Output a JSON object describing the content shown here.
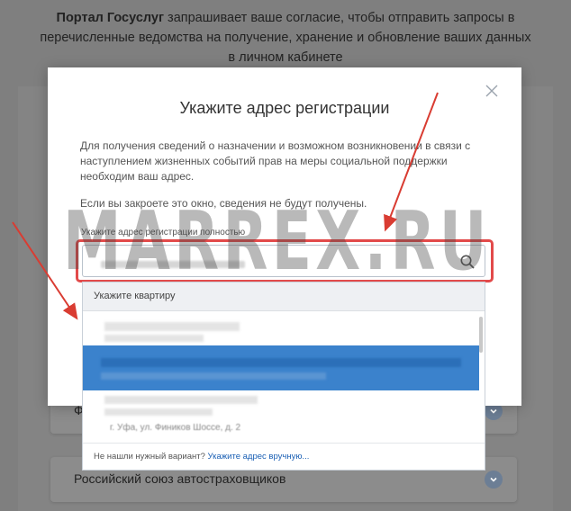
{
  "background": {
    "header_bold": "Портал Госуслуг",
    "header_text": " запрашивает ваше согласие, чтобы отправить запросы в перечисленные ведомства на получение, хранение и обновление ваших данных в личном кабинете",
    "row1_label": "Ф",
    "row2_label": "Российский союз автостраховщиков"
  },
  "modal": {
    "title": "Укажите адрес регистрации",
    "description": "Для получения сведений о назначении и возможном возникновении в связи с наступлением жизненных событий прав на меры социальной поддержки необходим ваш адрес.",
    "warning": "Если вы закроете это окно, сведения не будут получены.",
    "field_label": "Укажите адрес регистрации полностью"
  },
  "dropdown": {
    "apartment_label": "Укажите квартиру",
    "option_partial": "г. Уфа, ул. Фиников Шоссе, д. 2",
    "footer_text": "Не нашли нужный вариант? ",
    "footer_link": "Укажите адрес вручную..."
  },
  "watermark": "MARREX.RU",
  "colors": {
    "highlight_outline": "#e24a4a",
    "selected_option": "#3b82cc",
    "link": "#1a5fb4",
    "arrow": "#d93c32"
  }
}
